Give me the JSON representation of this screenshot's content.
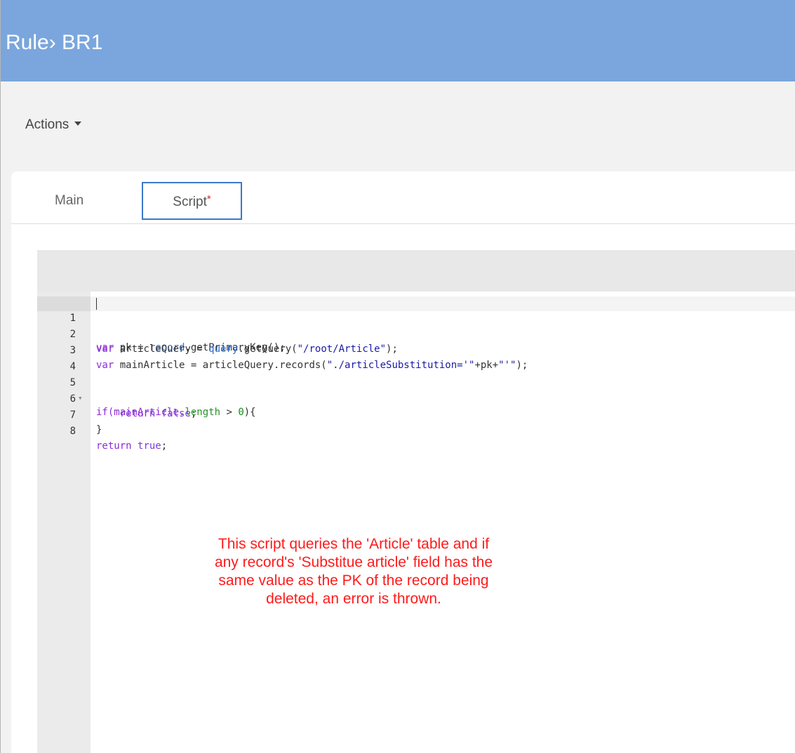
{
  "header": {
    "title": "Rule› BR1"
  },
  "toolbar": {
    "actions_label": "Actions"
  },
  "tabs": [
    {
      "label": "Main"
    },
    {
      "label": "Script",
      "modified_marker": "*"
    }
  ],
  "editor": {
    "lines": [
      {
        "n": "1"
      },
      {
        "n": "2"
      },
      {
        "n": "3"
      },
      {
        "n": "4"
      },
      {
        "n": "5"
      },
      {
        "n": "6"
      },
      {
        "n": "7"
      },
      {
        "n": "8"
      }
    ],
    "code": {
      "l1_kw": "var",
      "l1_a": " pk = ",
      "l1_obj": "record",
      "l1_b": ".getPrimaryKey();",
      "l2_kw": "var",
      "l2_a": " articleQuery = ",
      "l2_obj": "query",
      "l2_b": ".getQuery(",
      "l2_str": "\"/root/Article\"",
      "l2_c": ");",
      "l3_kw": "var",
      "l3_a": " mainArticle = articleQuery.records(",
      "l3_str": "\"./articleSubstitution='\"",
      "l3_b": "+pk+",
      "l3_str2": "\"'\"",
      "l3_c": ");",
      "l5_a": "if(mainArticle.",
      "l5_prop": "length",
      "l5_b": " > ",
      "l5_num": "0",
      "l5_c": "){",
      "l6_indent": "    ",
      "l6_kw": "return",
      "l6_space": " ",
      "l6_val": "false",
      "l6_end": ";",
      "l7": "}",
      "l8_kw": "return",
      "l8_space": " ",
      "l8_val": "true",
      "l8_end": ";"
    }
  },
  "annotation": {
    "line1": "This script queries the 'Article' table and if",
    "line2": "any record's 'Substitue article' field has the",
    "line3": "same value as the PK of the record being",
    "line4": "deleted, an error is thrown."
  },
  "colors": {
    "header_bg": "#7aa6dd",
    "tab_active_border": "#3b78cc",
    "modified_marker": "#d9232d",
    "annotation_text": "#ff1a1a"
  }
}
